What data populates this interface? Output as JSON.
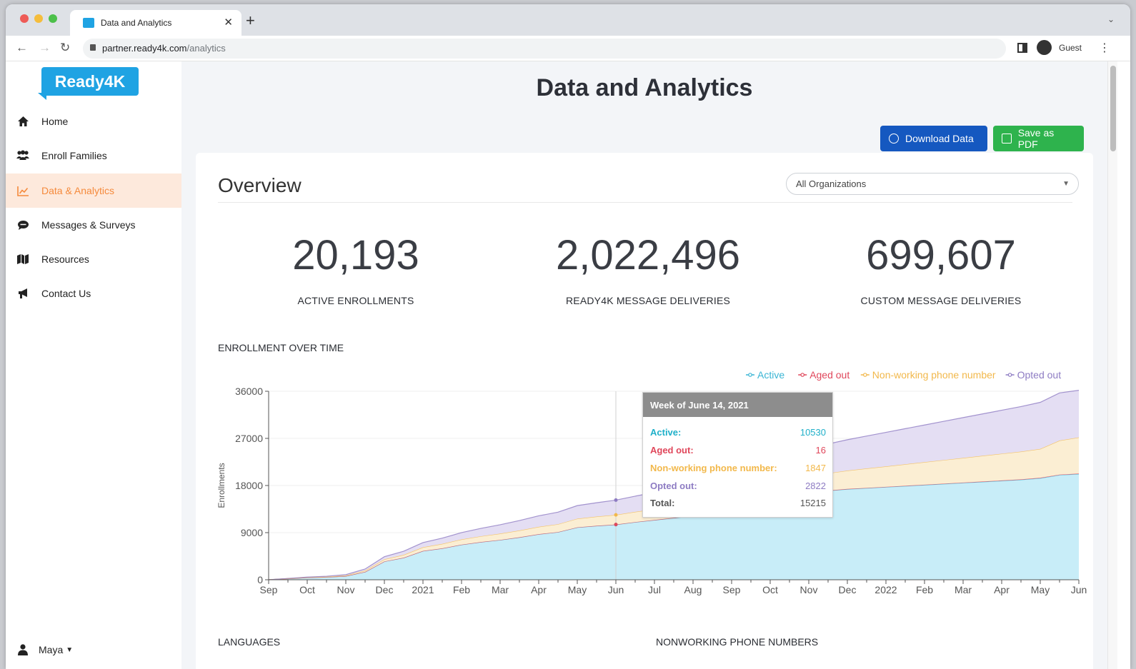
{
  "browser": {
    "tab_title": "Data and Analytics",
    "url_host": "partner.ready4k.com",
    "url_path": "/analytics",
    "profile_label": "Guest"
  },
  "sidebar": {
    "logo": "Ready4K",
    "items": [
      {
        "label": "Home",
        "icon": "home-icon"
      },
      {
        "label": "Enroll Families",
        "icon": "users-icon"
      },
      {
        "label": "Data & Analytics",
        "icon": "chart-line-icon"
      },
      {
        "label": "Messages & Surveys",
        "icon": "chat-icon"
      },
      {
        "label": "Resources",
        "icon": "map-icon"
      },
      {
        "label": "Contact Us",
        "icon": "megaphone-icon"
      }
    ],
    "user": "Maya"
  },
  "main": {
    "page_title": "Data and Analytics",
    "download_label": "Download Data",
    "pdf_label": "Save as PDF",
    "overview_title": "Overview",
    "org_select": "All Organizations",
    "stats": [
      {
        "value": "20,193",
        "label": "ACTIVE ENROLLMENTS"
      },
      {
        "value": "2,022,496",
        "label": "READY4K MESSAGE DELIVERIES"
      },
      {
        "value": "699,607",
        "label": "CUSTOM MESSAGE DELIVERIES"
      }
    ],
    "enrollment_label": "ENROLLMENT OVER TIME",
    "languages_label": "LANGUAGES",
    "nonworking_label": "NONWORKING PHONE NUMBERS"
  },
  "tooltip": {
    "title": "Week of June 14, 2021",
    "rows": [
      {
        "k": "Active:",
        "v": "10530"
      },
      {
        "k": "Aged out:",
        "v": "16"
      },
      {
        "k": "Non-working phone number:",
        "v": "1847"
      },
      {
        "k": "Opted out:",
        "v": "2822"
      },
      {
        "k": "Total:",
        "v": "15215"
      }
    ]
  },
  "colors": {
    "active": "#3ab5d4",
    "aged_out": "#e0475b",
    "nonworking": "#f2b84b",
    "opted_out": "#8e7cc3"
  },
  "chart_data": {
    "type": "area",
    "ylabel": "Enrollments",
    "ylim": [
      0,
      36000
    ],
    "y_ticks": [
      "36000",
      "27000",
      "18000",
      "9000",
      "0"
    ],
    "x": [
      "Sep",
      "",
      "Oct",
      "",
      "Nov",
      "",
      "Dec",
      "",
      "2021",
      "",
      "Feb",
      "",
      "Mar",
      "",
      "Apr",
      "",
      "May",
      "",
      "Jun",
      "",
      "Jul",
      "",
      "Aug",
      "",
      "Sep",
      "",
      "Oct",
      "",
      "Nov",
      "",
      "Dec",
      "",
      "2022",
      "",
      "Feb",
      "",
      "Mar",
      "",
      "Apr",
      "",
      "May",
      "",
      "Jun"
    ],
    "x_tick_labels": [
      "Sep",
      "Oct",
      "Nov",
      "Dec",
      "2021",
      "Feb",
      "Mar",
      "Apr",
      "May",
      "Jun",
      "Jul",
      "Aug",
      "Sep",
      "Oct",
      "Nov",
      "Dec",
      "2022",
      "Feb",
      "Mar",
      "Apr",
      "May",
      "Jun"
    ],
    "stacked": true,
    "legend_position": "top-right",
    "series": [
      {
        "name": "Active",
        "values": [
          0,
          200,
          400,
          500,
          700,
          1500,
          3500,
          4200,
          5500,
          6000,
          6700,
          7200,
          7600,
          8100,
          8700,
          9100,
          10000,
          10300,
          10530,
          11000,
          11400,
          11800,
          12200,
          12500,
          12800,
          13000,
          13200,
          13500,
          13800,
          17000,
          17300,
          17500,
          17700,
          17900,
          18100,
          18300,
          18500,
          18700,
          18900,
          19100,
          19400,
          20000,
          20193
        ]
      },
      {
        "name": "Aged out",
        "values": [
          0,
          0,
          0,
          0,
          0,
          0,
          0,
          2,
          3,
          4,
          5,
          6,
          7,
          8,
          9,
          10,
          12,
          14,
          16,
          18,
          20,
          22,
          24,
          26,
          28,
          30,
          32,
          34,
          36,
          40,
          44,
          48,
          52,
          56,
          60,
          64,
          68,
          72,
          76,
          80,
          84,
          88,
          92
        ]
      },
      {
        "name": "Non-working phone number",
        "values": [
          0,
          20,
          50,
          80,
          120,
          250,
          400,
          550,
          700,
          850,
          1000,
          1100,
          1200,
          1300,
          1400,
          1500,
          1650,
          1750,
          1847,
          1950,
          2050,
          2150,
          2250,
          2350,
          2450,
          2550,
          2650,
          2750,
          2850,
          3300,
          3500,
          3700,
          3900,
          4100,
          4300,
          4500,
          4700,
          4900,
          5100,
          5300,
          5500,
          6500,
          6900
        ]
      },
      {
        "name": "Opted out",
        "values": [
          0,
          30,
          60,
          90,
          150,
          300,
          500,
          700,
          900,
          1100,
          1300,
          1500,
          1700,
          1900,
          2100,
          2300,
          2500,
          2650,
          2822,
          3000,
          3200,
          3400,
          3600,
          3800,
          4000,
          4200,
          4400,
          4600,
          4800,
          5600,
          5900,
          6200,
          6500,
          6800,
          7100,
          7400,
          7700,
          8000,
          8300,
          8600,
          8900,
          9100,
          9000
        ]
      }
    ]
  }
}
